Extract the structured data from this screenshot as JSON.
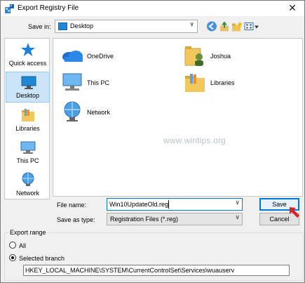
{
  "window": {
    "title": "Export Registry File",
    "close_glyph": "✕"
  },
  "save_in": {
    "label": "Save in:",
    "value": "Desktop",
    "icon": "folder-icon"
  },
  "toolbar": {
    "back_icon": "back-icon",
    "up_icon": "up-folder-icon",
    "new_folder_icon": "new-folder-icon",
    "view_menu_icon": "view-menu-icon"
  },
  "places": [
    {
      "label": "Quick access",
      "icon": "star-icon",
      "selected": false
    },
    {
      "label": "Desktop",
      "icon": "desktop-icon",
      "selected": true
    },
    {
      "label": "Libraries",
      "icon": "libraries-icon",
      "selected": false
    },
    {
      "label": "This PC",
      "icon": "computer-icon",
      "selected": false
    },
    {
      "label": "Network",
      "icon": "network-icon",
      "selected": false
    }
  ],
  "files": [
    {
      "label": "OneDrive",
      "icon": "onedrive-icon"
    },
    {
      "label": "Joshua",
      "icon": "user-folder-icon"
    },
    {
      "label": "This PC",
      "icon": "computer-icon"
    },
    {
      "label": "Libraries",
      "icon": "libraries-icon"
    },
    {
      "label": "Network",
      "icon": "network-icon"
    }
  ],
  "watermark": "www.wintips.org",
  "file_name": {
    "label": "File name:",
    "value": "Win10UpdateOld.reg"
  },
  "save_as_type": {
    "label": "Save as type:",
    "value": "Registration Files (*.reg)"
  },
  "buttons": {
    "save": "Save",
    "cancel": "Cancel"
  },
  "export_range": {
    "title": "Export range",
    "all_label": "All",
    "selected_label": "Selected branch",
    "selected": "selected_branch",
    "branch_value": "HKEY_LOCAL_MACHINE\\SYSTEM\\CurrentControlSet\\Services\\wuauserv"
  },
  "colors": {
    "accent": "#0078d7",
    "selection": "#cce4f7",
    "annotation_arrow": "#e02020"
  }
}
